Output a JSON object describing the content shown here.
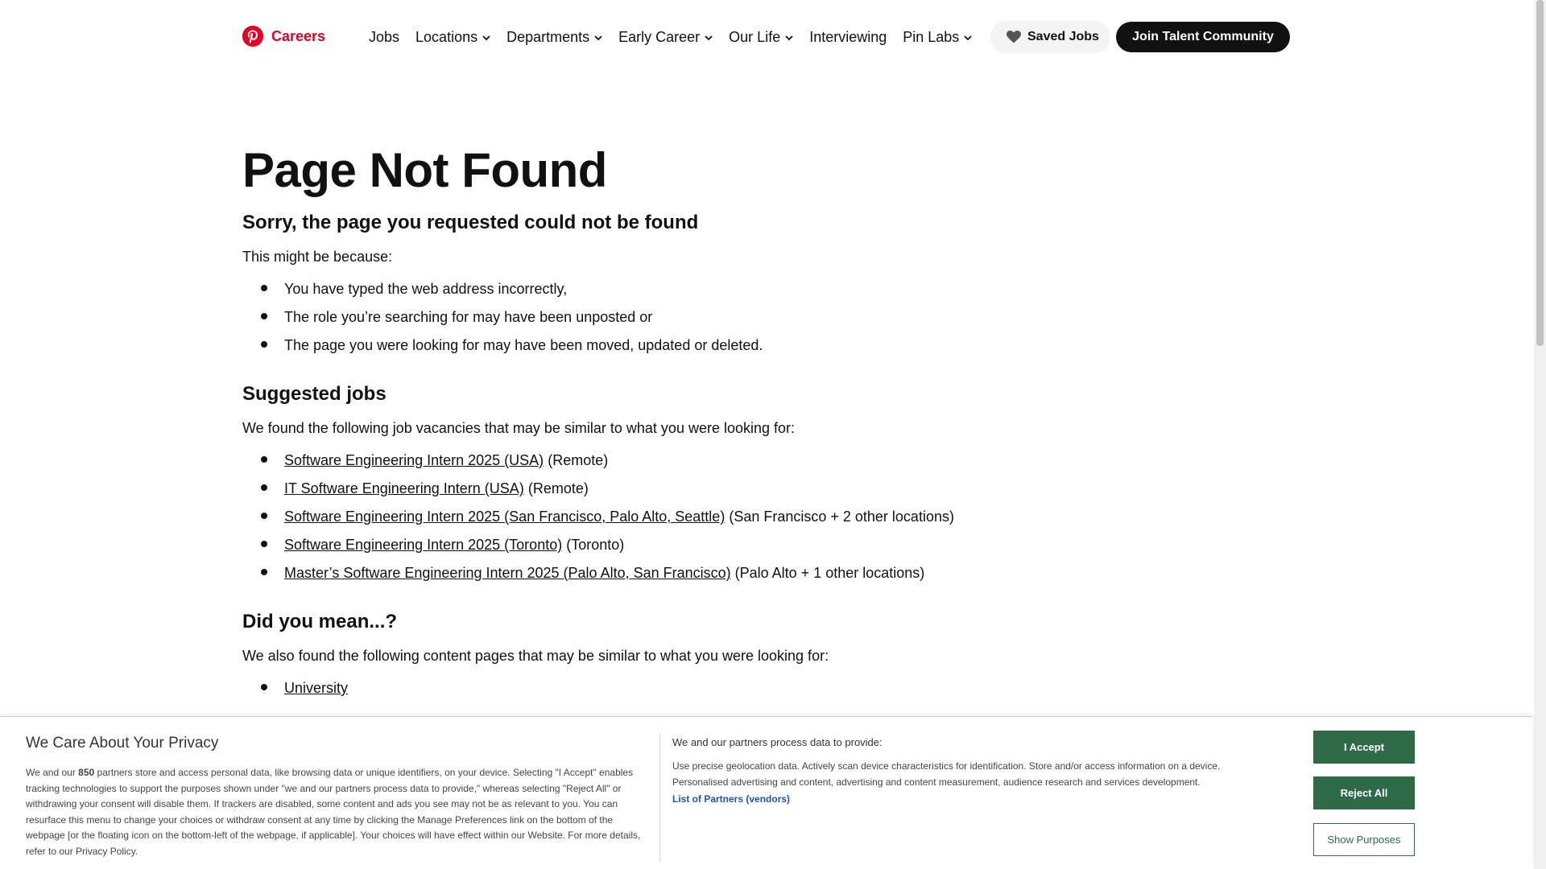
{
  "header": {
    "logo_text": "Careers",
    "nav": [
      {
        "label": "Jobs",
        "dropdown": false
      },
      {
        "label": "Locations",
        "dropdown": true
      },
      {
        "label": "Departments",
        "dropdown": true
      },
      {
        "label": "Early Career",
        "dropdown": true
      },
      {
        "label": "Our Life",
        "dropdown": true
      },
      {
        "label": "Interviewing",
        "dropdown": false
      },
      {
        "label": "Pin Labs",
        "dropdown": true
      }
    ],
    "saved_jobs": "Saved Jobs",
    "join": "Join Talent Community"
  },
  "main": {
    "title": "Page Not Found",
    "subtitle": "Sorry, the page you requested could not be found",
    "reason_intro": "This might be because:",
    "reasons": [
      "You have typed the web address incorrectly,",
      "The role you’re searching for may have been unposted or",
      "The page you were looking for may have been moved, updated or deleted."
    ],
    "suggested_heading": "Suggested jobs",
    "suggested_intro": "We found the following job vacancies that may be similar to what you were looking for:",
    "jobs": [
      {
        "title": "Software Engineering Intern 2025 (USA)",
        "location": "(Remote)"
      },
      {
        "title": "IT Software Engineering Intern (USA)",
        "location": "(Remote)"
      },
      {
        "title": "Software Engineering Intern 2025 (San Francisco, Palo Alto, Seattle)",
        "location": "(San Francisco + 2 other locations)"
      },
      {
        "title": "Software Engineering Intern 2025 (Toronto)",
        "location": "(Toronto)"
      },
      {
        "title": "Master’s Software Engineering Intern 2025 (Palo Alto, San Francisco)",
        "location": "(Palo Alto + 1 other locations)"
      }
    ],
    "didyoumean_heading": "Did you mean...?",
    "didyoumean_intro": "We also found the following content pages that may be similar to what you were looking for:",
    "pages": [
      "University"
    ]
  },
  "privacy": {
    "title": "We Care About Your Privacy",
    "body_pre": "We and our ",
    "partners_count": "850",
    "body_post": " partners store and access personal data, like browsing data or unique identifiers, on your device. Selecting \"I Accept\" enables tracking technologies to support the purposes shown under \"we and our partners process data to provide,\" whereas selecting \"Reject All\" or withdrawing your consent will disable them. If trackers are disabled, some content and ads you see may not be as relevant to you. You can resurface this menu to change your choices or withdraw consent at any time by clicking the Manage Preferences link on the bottom of the webpage [or the floating icon on the bottom-left of the webpage, if applicable]. Your choices will have effect within our Website. For more details, refer to our Privacy Policy.",
    "mid_title": "We and our partners process data to provide:",
    "mid_body": "Use precise geolocation data. Actively scan device characteristics for identification. Store and/or access information on a device. Personalised advertising and content, advertising and content measurement, audience research and services development.",
    "partners_link": "List of Partners (vendors)",
    "accept": "I Accept",
    "reject": "Reject All",
    "show": "Show Purposes"
  },
  "colors": {
    "brand": "#e60023",
    "consent_green": "#2f6a47",
    "link_blue": "#1f4fbf"
  }
}
